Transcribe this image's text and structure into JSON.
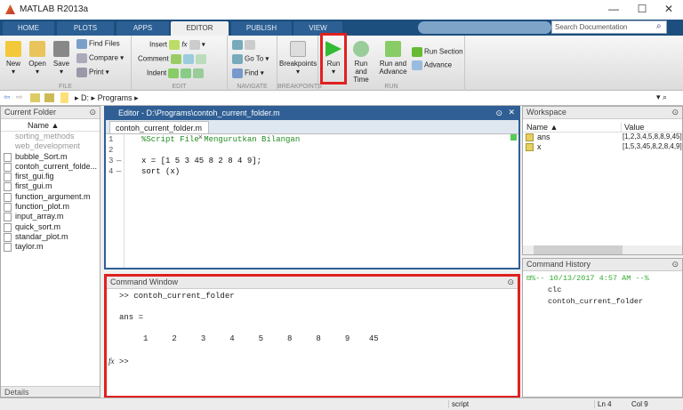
{
  "window": {
    "title": "MATLAB R2013a",
    "minimize": "—",
    "maximize": "☐",
    "close": "✕"
  },
  "tabs": [
    {
      "label": "HOME"
    },
    {
      "label": "PLOTS"
    },
    {
      "label": "APPS"
    },
    {
      "label": "EDITOR"
    },
    {
      "label": "PUBLISH"
    },
    {
      "label": "VIEW"
    }
  ],
  "search": {
    "placeholder": "Search Documentation"
  },
  "ribbon": {
    "file": {
      "label": "FILE",
      "new": "New",
      "open": "Open",
      "save": "Save",
      "find_files": "Find Files",
      "compare": "Compare",
      "print": "Print"
    },
    "edit": {
      "label": "EDIT",
      "insert": "Insert",
      "comment": "Comment",
      "indent": "Indent",
      "fx": "fx"
    },
    "navigate": {
      "label": "NAVIGATE",
      "goto": "Go To",
      "find": "Find"
    },
    "breakpoints": {
      "label": "BREAKPOINTS",
      "breakpoints": "Breakpoints"
    },
    "run": {
      "label": "RUN",
      "run": "Run",
      "run_and_time": "Run and Time",
      "run_and_advance": "Run and Advance",
      "run_section": "Run Section",
      "advance": "Advance"
    }
  },
  "address": {
    "path": [
      "D:",
      "Programs"
    ]
  },
  "current_folder": {
    "title": "Current Folder",
    "column": "Name ▲",
    "folders": [
      "sorting_methods",
      "web_development"
    ],
    "files": [
      "bubble_Sort.m",
      "contoh_current_folde...",
      "first_gui.fig",
      "first_gui.m",
      "function_argument.m",
      "function_plot.m",
      "input_array.m",
      "quick_sort.m",
      "standar_plot.m",
      "taylor.m"
    ],
    "details": "Details"
  },
  "editor": {
    "title": "Editor - D:\\Programs\\contoh_current_folder.m",
    "tab": "contoh_current_folder.m",
    "lines": [
      {
        "n": "1",
        "mark": "",
        "code": "%Script File Mengurutkan Bilangan",
        "comment": true
      },
      {
        "n": "2",
        "mark": "",
        "code": ""
      },
      {
        "n": "3",
        "mark": "—",
        "code": "x = [1 5 3 45 8 2 8 4 9];"
      },
      {
        "n": "4",
        "mark": "—",
        "code": "sort (x)"
      }
    ]
  },
  "command_window": {
    "title": "Command Window",
    "lines": [
      ">> contoh_current_folder",
      "",
      "ans =",
      "",
      "     1     2     3     4     5     8     8     9    45",
      ""
    ],
    "prompt": ">>",
    "fx": "fx"
  },
  "workspace": {
    "title": "Workspace",
    "columns": [
      "Name ▲",
      "Value"
    ],
    "rows": [
      {
        "name": "ans",
        "value": "[1,2,3,4,5,8,8,9,45]"
      },
      {
        "name": "x",
        "value": "[1,5,3,45,8,2,8,4,9]"
      }
    ]
  },
  "history": {
    "title": "Command History",
    "session": "%-- 10/13/2017 4:57 AM --%",
    "items": [
      "clc",
      "contoh_current_folder"
    ]
  },
  "status": {
    "mode": "script",
    "ln_label": "Ln",
    "ln": "4",
    "col_label": "Col",
    "col": "9"
  },
  "colors": {
    "tabbar": "#1c4e7e",
    "editor_border": "#2f5f95",
    "highlight": "#e02020",
    "comment": "#228b22"
  }
}
